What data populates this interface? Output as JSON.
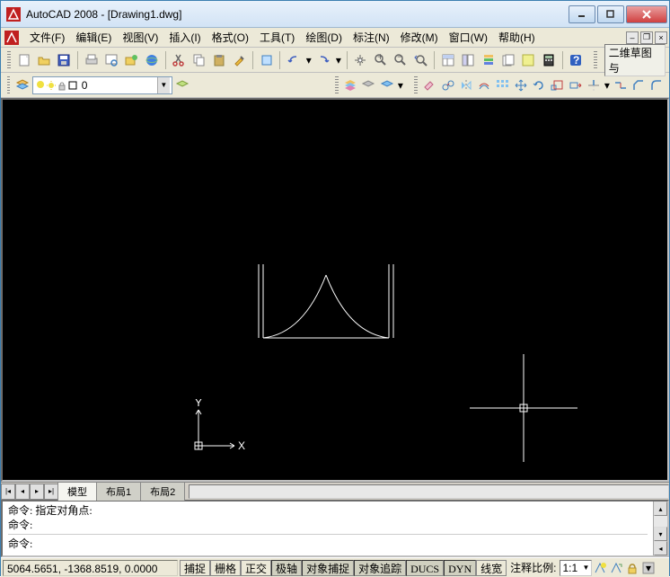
{
  "titlebar": {
    "title": "AutoCAD 2008 - [Drawing1.dwg]"
  },
  "menu": {
    "items": [
      {
        "label": "文件(F)"
      },
      {
        "label": "编辑(E)"
      },
      {
        "label": "视图(V)"
      },
      {
        "label": "插入(I)"
      },
      {
        "label": "格式(O)"
      },
      {
        "label": "工具(T)"
      },
      {
        "label": "绘图(D)"
      },
      {
        "label": "标注(N)"
      },
      {
        "label": "修改(M)"
      },
      {
        "label": "窗口(W)"
      },
      {
        "label": "帮助(H)"
      }
    ]
  },
  "toolbar1_right_text": "二维草图与",
  "layer": {
    "current": "0"
  },
  "ucs": {
    "x_label": "X",
    "y_label": "Y"
  },
  "tabs": {
    "items": [
      {
        "label": "模型",
        "active": true
      },
      {
        "label": "布局1",
        "active": false
      },
      {
        "label": "布局2",
        "active": false
      }
    ]
  },
  "command": {
    "line1": "命令: 指定对角点:",
    "line2": "命令:",
    "prompt": "命令:"
  },
  "status": {
    "coords": "5064.5651, -1368.8519, 0.0000",
    "snap": "捕捉",
    "grid": "栅格",
    "ortho": "正交",
    "polar": "极轴",
    "osnap": "对象捕捉",
    "otrack": "对象追踪",
    "ducs": "DUCS",
    "dyn": "DYN",
    "lwt": "线宽",
    "anno_label": "注释比例:",
    "anno_value": "1:1"
  }
}
